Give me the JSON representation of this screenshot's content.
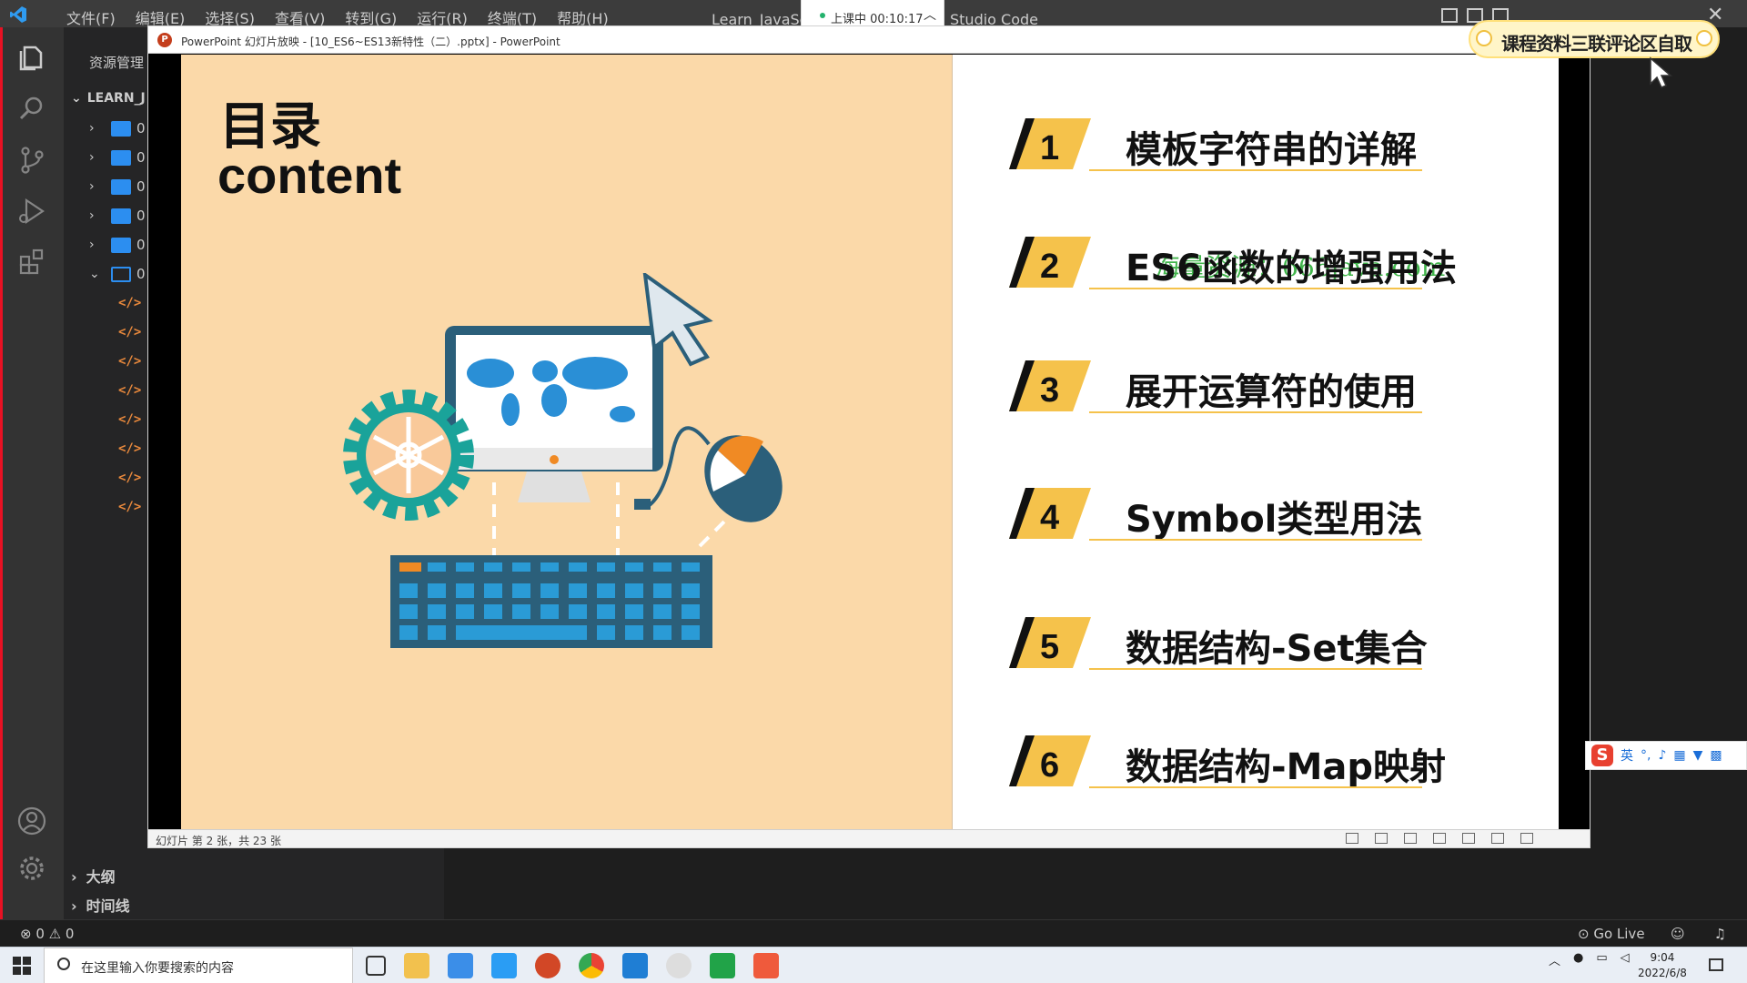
{
  "vscode": {
    "menu": [
      "文件(F)",
      "编辑(E)",
      "选择(S)",
      "查看(V)",
      "转到(G)",
      "运行(R)",
      "终端(T)",
      "帮助(H)"
    ],
    "window_title_part1": "Learn_JavaSc",
    "window_title_part2": "Studio Code",
    "sidebar_header": "资源管理",
    "project_name": "LEARN_J",
    "folders": [
      "0",
      "0",
      "0",
      "0",
      "0",
      "0"
    ],
    "file_tag": "</>",
    "outline_label": "大纲",
    "timeline_label": "时间线",
    "status_problems": "⊗ 0 ⚠ 0",
    "status_golive": "Go Live"
  },
  "recording": {
    "label": "上课中 00:10:17"
  },
  "powerpoint": {
    "window_title": "PowerPoint 幻灯片放映 - [10_ES6~ES13新特性（二）.pptx] - PowerPoint",
    "status_text": "幻灯片 第 2 张，共 23 张"
  },
  "slide": {
    "title_zh": "目录",
    "title_en": "content",
    "watermark": "海量资源：666java.com",
    "toc": [
      {
        "num": "1",
        "text": "模板字符串的详解"
      },
      {
        "num": "2",
        "text": "ES6函数的增强用法"
      },
      {
        "num": "3",
        "text": "展开运算符的使用"
      },
      {
        "num": "4",
        "text": "Symbol类型用法"
      },
      {
        "num": "5",
        "text": "数据结构-Set集合"
      },
      {
        "num": "6",
        "text": "数据结构-Map映射"
      }
    ]
  },
  "promo": {
    "text": "课程资料三联评论区自取"
  },
  "ime": {
    "lang": "英"
  },
  "taskbar": {
    "search_placeholder": "在这里输入你要搜索的内容",
    "time": "9:04",
    "date": "2022/6/8"
  },
  "colors": {
    "slide_left_bg": "#fbd9a9",
    "badge_yellow": "#f5c24b",
    "vscode_bg": "#1e1e1e",
    "ppt_icon": "#c43e1c"
  }
}
